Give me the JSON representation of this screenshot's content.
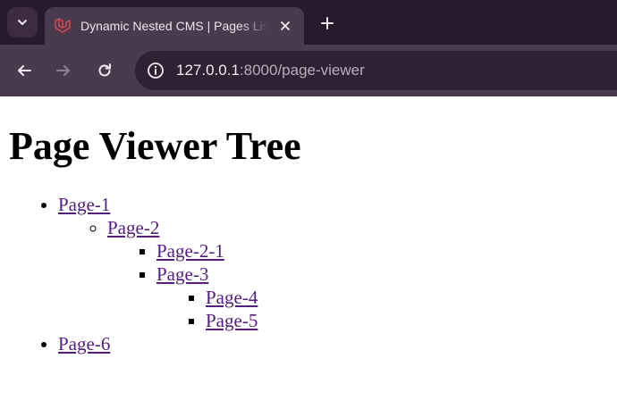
{
  "browser": {
    "tab_title": "Dynamic Nested CMS | Pages List",
    "url_host": "127.0.0.1",
    "url_rest": ":8000/page-viewer"
  },
  "page": {
    "title": "Page Viewer Tree",
    "tree": [
      {
        "label": "Page-1",
        "children": [
          {
            "label": "Page-2",
            "children": [
              {
                "label": "Page-2-1"
              },
              {
                "label": "Page-3",
                "children": [
                  {
                    "label": "Page-4"
                  },
                  {
                    "label": "Page-5"
                  }
                ]
              }
            ]
          }
        ]
      },
      {
        "label": "Page-6"
      }
    ]
  },
  "icons": {
    "tab_menu": "chevron-down-icon",
    "favicon": "laravel-logo-icon",
    "tab_close": "close-icon",
    "new_tab": "plus-icon",
    "back": "arrow-left-icon",
    "forward": "arrow-right-icon",
    "reload": "reload-icon",
    "site_info": "info-icon"
  },
  "colors": {
    "link": "#551a8b",
    "chrome_bg": "#281a2c",
    "toolbar_bg": "#4a3a4e",
    "favicon": "#e0454f"
  }
}
